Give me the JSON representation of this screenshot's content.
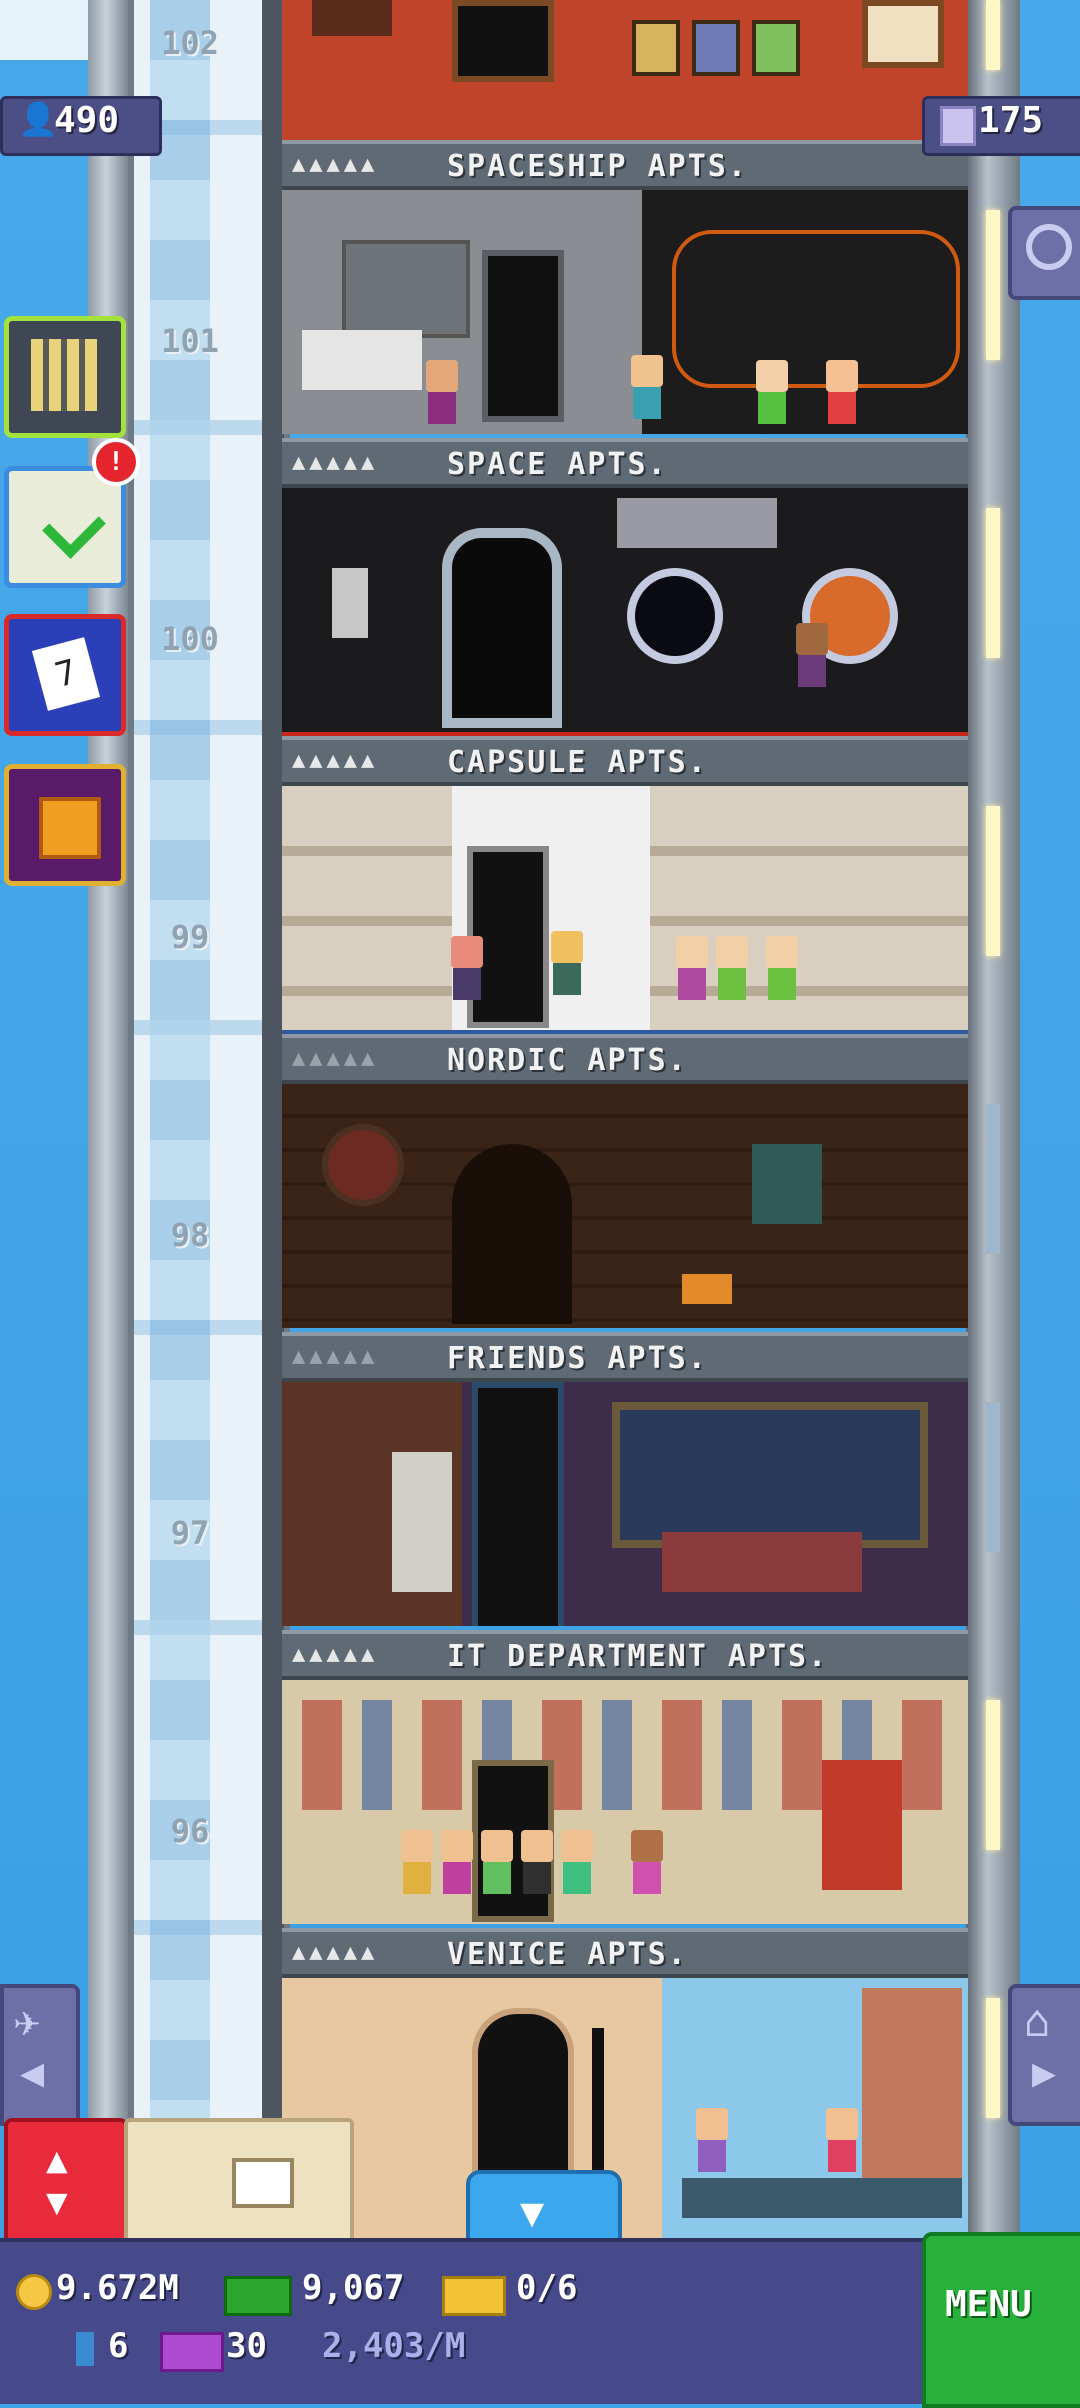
{
  "hud": {
    "population": "490",
    "floor_count": "175"
  },
  "floors": [
    {
      "number": "102",
      "name": "",
      "stars": "",
      "scene": "brick"
    },
    {
      "number": "101",
      "name": "SPACESHIP APTS.",
      "stars": "▲▲▲▲▲",
      "scene": "spaceship"
    },
    {
      "number": "100",
      "name": "SPACE APTS.",
      "stars": "▲▲▲▲▲",
      "scene": "space"
    },
    {
      "number": "99",
      "name": "CAPSULE APTS.",
      "stars": "▲▲▲▲▲",
      "scene": "capsule"
    },
    {
      "number": "98",
      "name": "NORDIC APTS.",
      "stars": "▲▲▲▲▲",
      "scene": "nordic"
    },
    {
      "number": "97",
      "name": "FRIENDS APTS.",
      "stars": "▲▲▲▲▲",
      "scene": "friends"
    },
    {
      "number": "96",
      "name": "IT DEPARTMENT APTS.",
      "stars": "▲▲▲▲▲",
      "scene": "it"
    },
    {
      "number": "",
      "name": "VENICE APTS.",
      "stars": "▲▲▲▲▲",
      "scene": "venice"
    }
  ],
  "side_buttons": {
    "missions_badge": "!",
    "calendar_day": "7"
  },
  "status": {
    "coins": "9.672M",
    "bux": "9,067",
    "tickets": "0/6",
    "keys": "6",
    "vip": "30",
    "income": "2,403/M"
  },
  "menu_label": "MENU",
  "colors": {
    "sky": "#3fa6e6",
    "hud_bar": "#46498a",
    "menu_green": "#27b03a",
    "elevator_red": "#e82a3a"
  }
}
